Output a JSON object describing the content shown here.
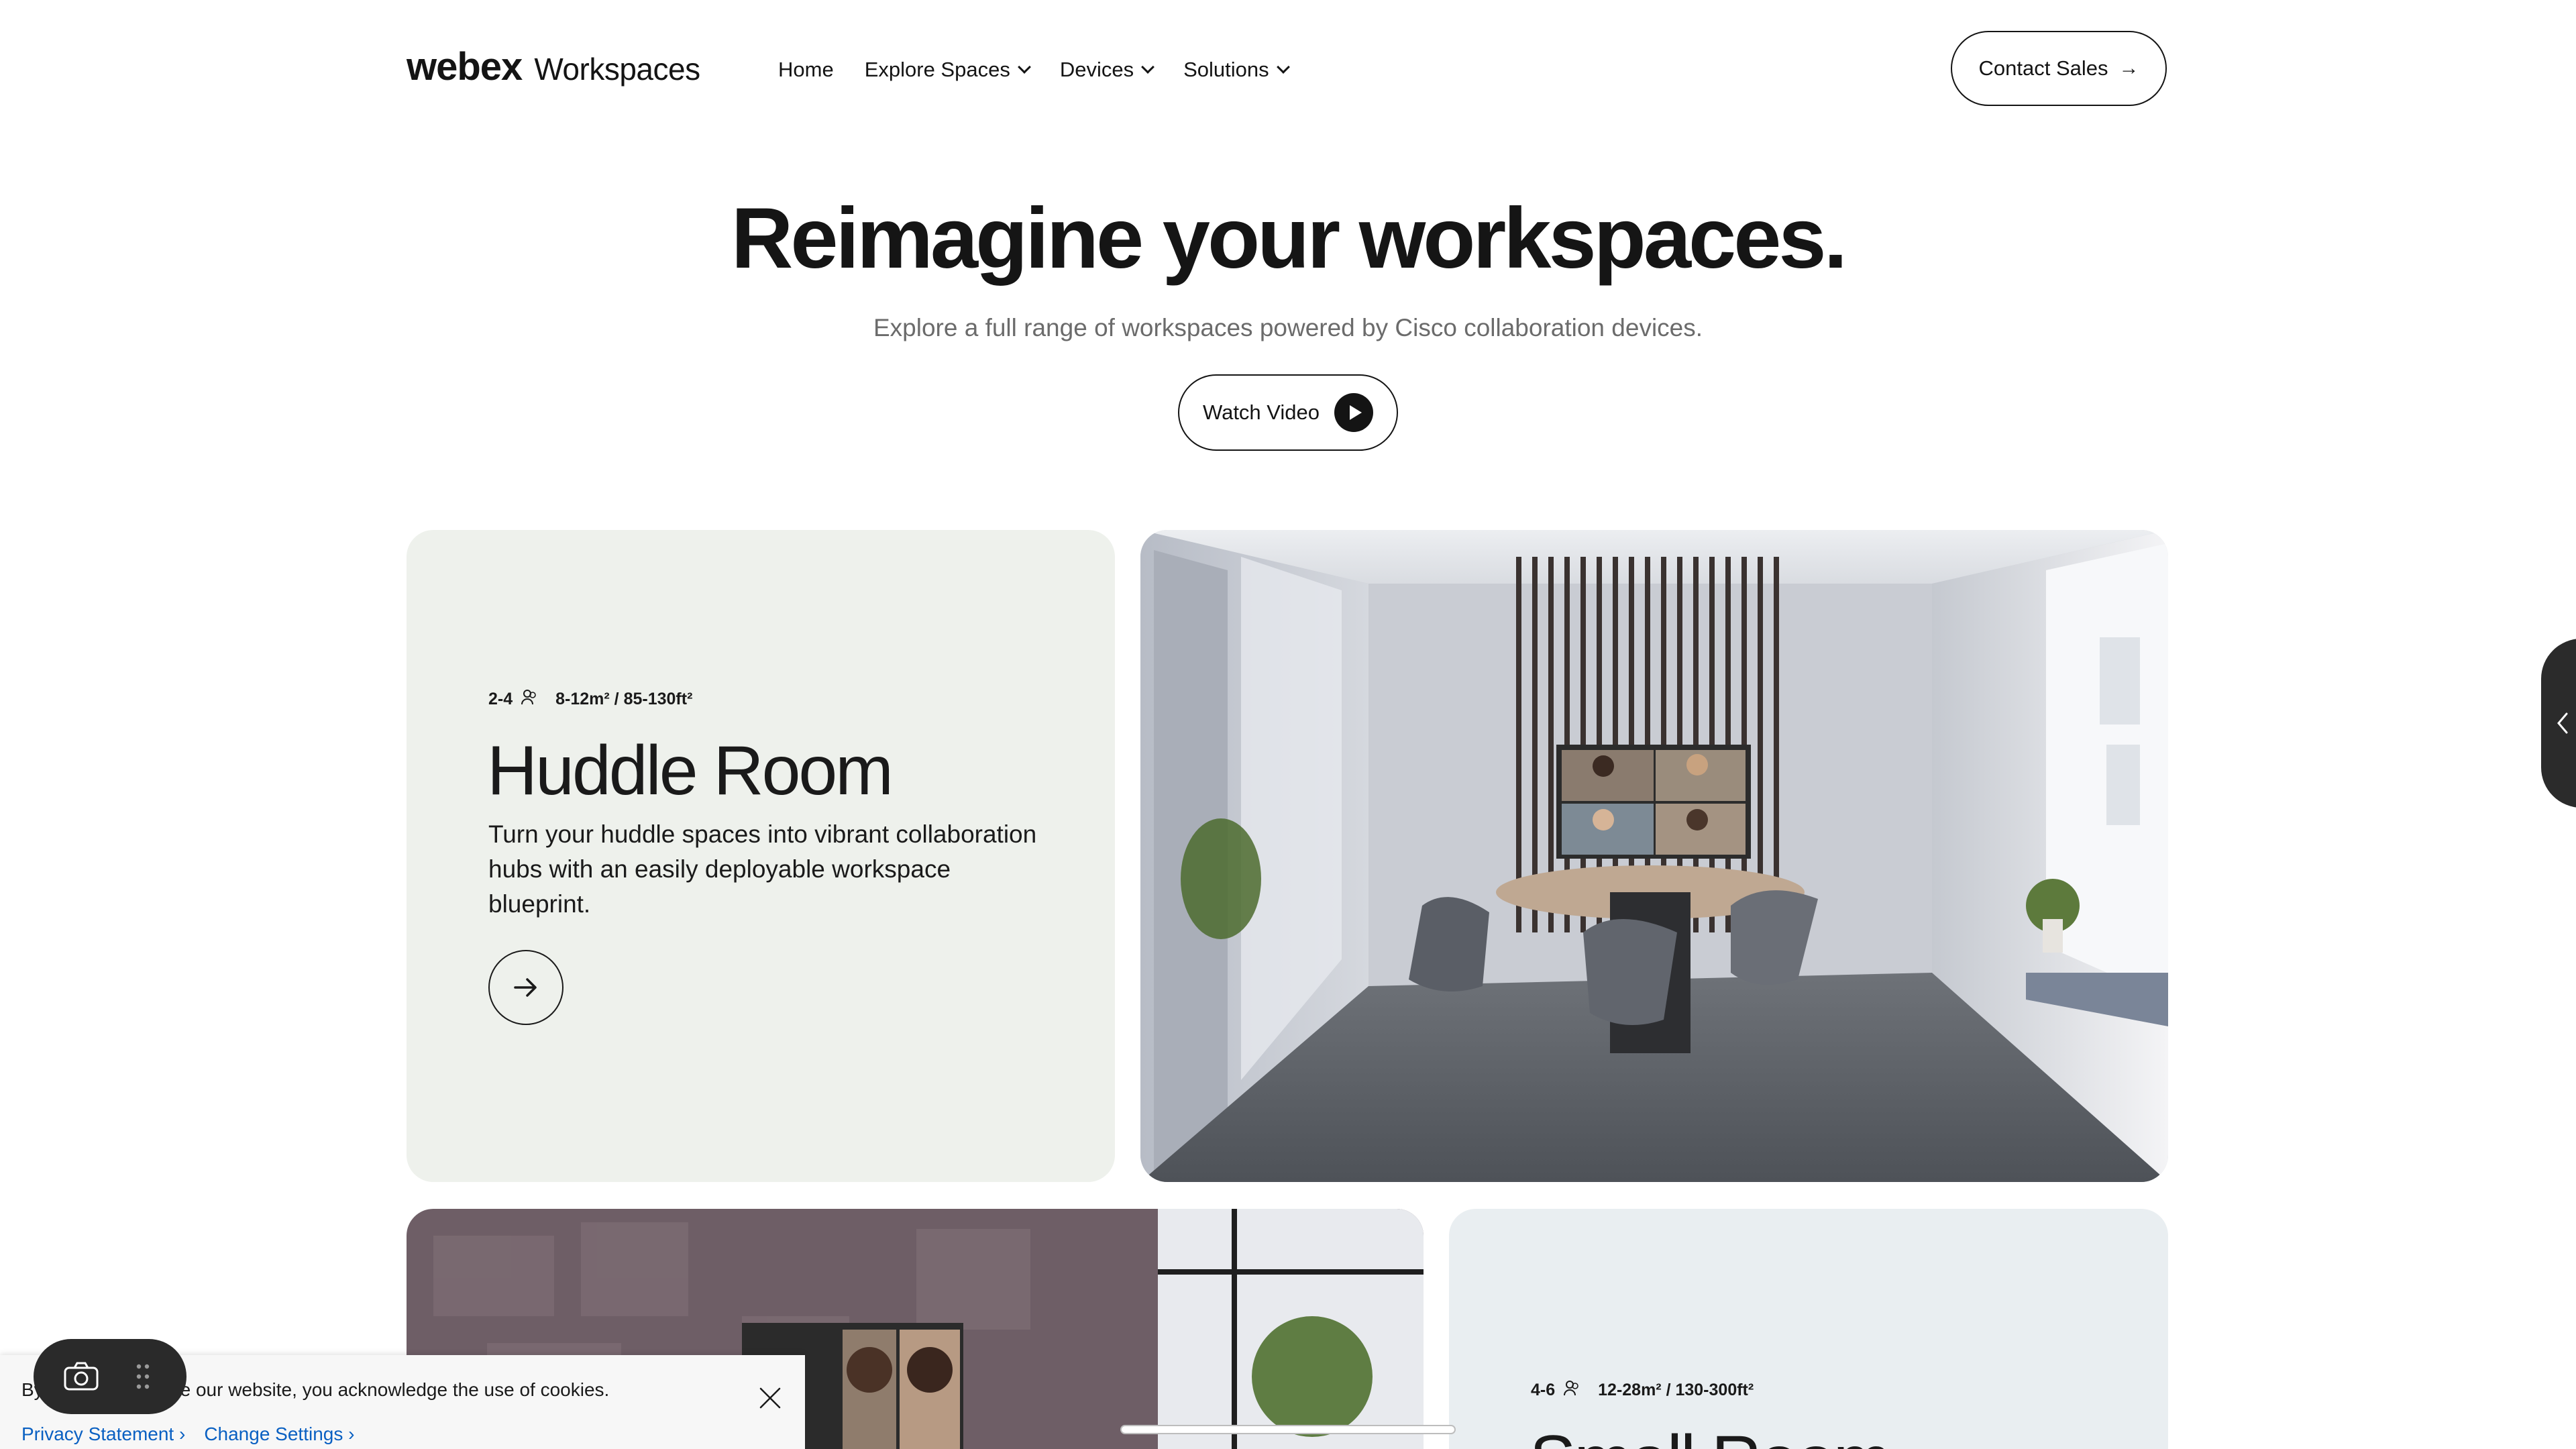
{
  "header": {
    "logo_brand": "webex",
    "logo_product": "Workspaces",
    "nav": [
      {
        "label": "Home",
        "has_dropdown": false
      },
      {
        "label": "Explore Spaces",
        "has_dropdown": true
      },
      {
        "label": "Devices",
        "has_dropdown": true
      },
      {
        "label": "Solutions",
        "has_dropdown": true
      }
    ],
    "contact_label": "Contact Sales"
  },
  "hero": {
    "title": "Reimagine your workspaces.",
    "subtitle": "Explore a full range of workspaces powered by Cisco collaboration devices.",
    "watch_label": "Watch Video"
  },
  "cards": {
    "huddle": {
      "people": "2-4",
      "area": "8-12m² / 85-130ft²",
      "title": "Huddle Room",
      "description": "Turn your huddle spaces into vibrant collaboration hubs with an easily deployable workspace blueprint."
    },
    "small": {
      "people": "4-6",
      "area": "12-28m² / 130-300ft²",
      "title": "Small Room"
    }
  },
  "cookie": {
    "text": "By continuing to use our website, you acknowledge the use of cookies.",
    "privacy_label": "Privacy Statement ›",
    "settings_label": "Change Settings ›"
  },
  "icons": {
    "people": "person-icon",
    "arrow": "arrow-right-icon",
    "play": "play-icon",
    "close": "close-icon",
    "camera": "camera-icon",
    "drag": "drag-handle-icon",
    "collapse": "chevron-left-icon"
  },
  "colors": {
    "huddle_card_bg": "#eef1ec",
    "small_card_bg": "#e9eef1",
    "link_blue": "#0a60c2"
  }
}
